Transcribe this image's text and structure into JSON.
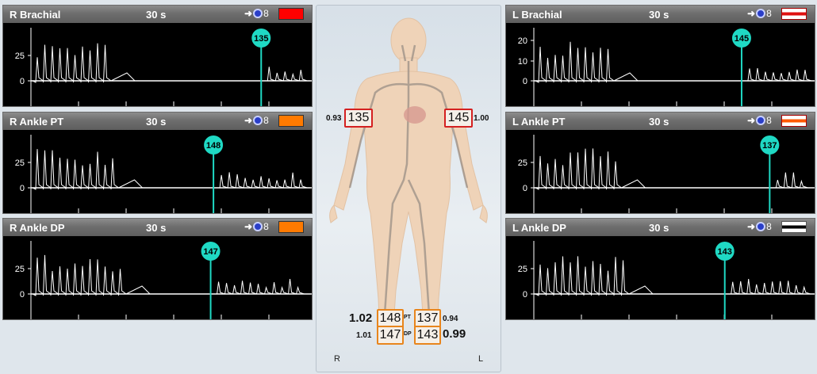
{
  "panels": [
    {
      "id": "r-brachial",
      "name": "R Brachial",
      "duration": "30 s",
      "probe_count": "8",
      "swatch": "red",
      "cursor_value": "135",
      "y_ticks": [
        "25",
        "0"
      ],
      "cursor_frac": 0.82
    },
    {
      "id": "r-ankle-pt",
      "name": "R Ankle PT",
      "duration": "30 s",
      "probe_count": "8",
      "swatch": "orange",
      "cursor_value": "148",
      "y_ticks": [
        "25",
        "0"
      ],
      "cursor_frac": 0.65
    },
    {
      "id": "r-ankle-dp",
      "name": "R Ankle DP",
      "duration": "30 s",
      "probe_count": "8",
      "swatch": "orange",
      "cursor_value": "147",
      "y_ticks": [
        "25",
        "0"
      ],
      "cursor_frac": 0.64
    },
    {
      "id": "l-brachial",
      "name": "L Brachial",
      "duration": "30 s",
      "probe_count": "8",
      "swatch": "white-red-stripe",
      "cursor_value": "145",
      "y_ticks": [
        "20",
        "10",
        "0"
      ],
      "cursor_frac": 0.74
    },
    {
      "id": "l-ankle-pt",
      "name": "L Ankle PT",
      "duration": "30 s",
      "probe_count": "8",
      "swatch": "white-orange-stripe",
      "cursor_value": "137",
      "y_ticks": [
        "25",
        "0"
      ],
      "cursor_frac": 0.84
    },
    {
      "id": "l-ankle-dp",
      "name": "L Ankle DP",
      "duration": "30 s",
      "probe_count": "8",
      "swatch": "white-black-stripe",
      "cursor_value": "143",
      "y_ticks": [
        "25",
        "0"
      ],
      "cursor_frac": 0.68
    }
  ],
  "body": {
    "r_brachial": {
      "index": "0.93",
      "pressure": "135"
    },
    "l_brachial": {
      "index": "1.00",
      "pressure": "145"
    },
    "pt": {
      "r_index": "1.02",
      "r_pressure": "148",
      "label": "PT",
      "l_pressure": "137",
      "l_index": "0.94"
    },
    "dp": {
      "r_index": "1.01",
      "r_pressure": "147",
      "label": "DP",
      "l_pressure": "143",
      "l_index": "0.99"
    },
    "side_right": "R",
    "side_left": "L"
  },
  "colors": {
    "cursor": "#1fd9c4",
    "red": "#ff0000",
    "orange": "#ff7a00",
    "wave": "#ffffff"
  }
}
